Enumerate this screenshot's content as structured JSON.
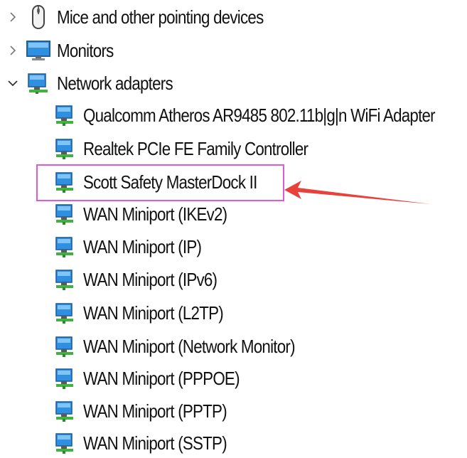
{
  "colors": {
    "highlight_box": "#e05ad7",
    "arrow": "#e8413c",
    "chevron": "#777777"
  },
  "categories": [
    {
      "label": "Mice and other pointing devices",
      "icon": "mouse-icon",
      "state": "collapsed"
    },
    {
      "label": "Monitors",
      "icon": "monitor-icon",
      "state": "collapsed"
    },
    {
      "label": "Network adapters",
      "icon": "network-adapter-icon",
      "state": "expanded"
    }
  ],
  "network_adapters": [
    "Qualcomm Atheros AR9485 802.11b|g|n WiFi Adapter",
    "Realtek PCIe FE Family Controller",
    "Scott Safety MasterDock II",
    "WAN Miniport (IKEv2)",
    "WAN Miniport (IP)",
    "WAN Miniport (IPv6)",
    "WAN Miniport (L2TP)",
    "WAN Miniport (Network Monitor)",
    "WAN Miniport (PPPOE)",
    "WAN Miniport (PPTP)",
    "WAN Miniport (SSTP)"
  ],
  "annotation": {
    "highlighted_item": "Scott Safety MasterDock II",
    "arrow_icon": "red-arrow-icon"
  }
}
